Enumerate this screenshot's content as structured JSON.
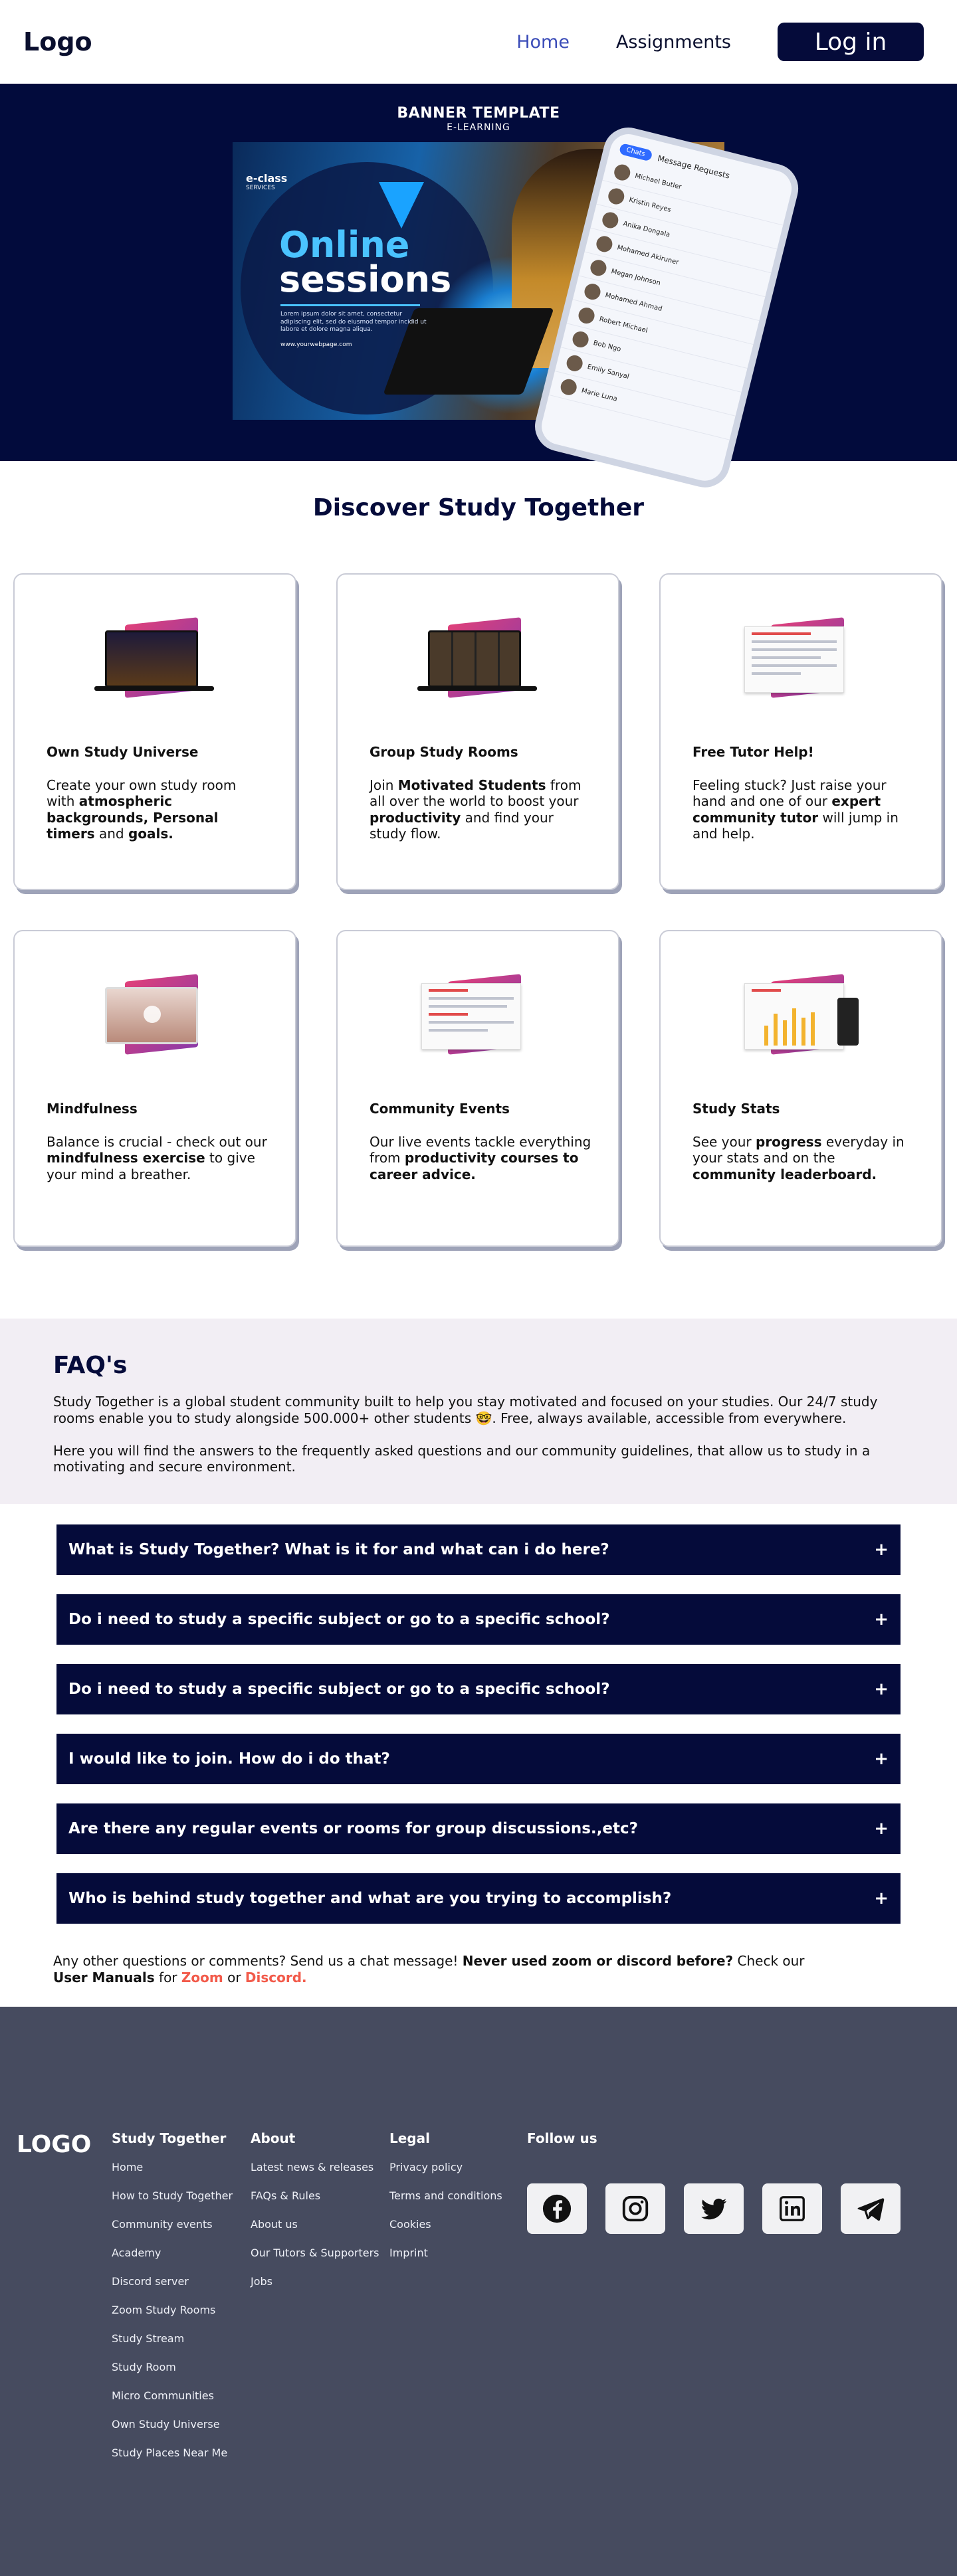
{
  "header": {
    "logo": "Logo",
    "nav": {
      "home": "Home",
      "assignments": "Assignments",
      "login": "Log in"
    }
  },
  "banner": {
    "title": "BANNER TEMPLATE",
    "subtitle": "E-LEARNING",
    "art": {
      "brand": "e-class",
      "brand_sub": "SERVICES",
      "headline_1": "Online",
      "headline_2": "sessions",
      "lorem": "Lorem ipsum dolor sit amet, consectetur adipiscing elit, sed do eiusmod tempor incidid ut labore et dolore magna aliqua.",
      "url": "www.yourwebpage.com",
      "phone_tab_1": "Chats",
      "phone_tab_2": "Message Requests",
      "phone_contacts": [
        "Michael Butler",
        "Kristin Reyes",
        "Anika Dongala",
        "Mohamed Akiruner",
        "Megan Johnson",
        "Mohamed Ahmad",
        "Robert Michael",
        "Bob Ngo",
        "Emily Sanyal",
        "Marie Luna"
      ]
    }
  },
  "discover": {
    "title": "Discover Study Together",
    "cards": [
      {
        "heading": "Own Study Universe",
        "body": [
          {
            "t": "Create your own study room with ",
            "b": false
          },
          {
            "t": "atmospheric backgrounds, Personal timers",
            "b": true
          },
          {
            "t": " and ",
            "b": false
          },
          {
            "t": "goals.",
            "b": true
          }
        ]
      },
      {
        "heading": "Group Study Rooms",
        "body": [
          {
            "t": "Join ",
            "b": false
          },
          {
            "t": "Motivated Students",
            "b": true
          },
          {
            "t": " from all over the world to boost your ",
            "b": false
          },
          {
            "t": "productivity",
            "b": true
          },
          {
            "t": " and find your study flow.",
            "b": false
          }
        ]
      },
      {
        "heading": "Free Tutor Help!",
        "body": [
          {
            "t": "Feeling stuck? Just raise your hand and one of our ",
            "b": false
          },
          {
            "t": "expert community tutor",
            "b": true
          },
          {
            "t": " will jump in and help.",
            "b": false
          }
        ]
      },
      {
        "heading": "Mindfulness",
        "body": [
          {
            "t": "Balance is crucial - check out our ",
            "b": false
          },
          {
            "t": "mindfulness exercise",
            "b": true
          },
          {
            "t": " to give your mind a breather.",
            "b": false
          }
        ]
      },
      {
        "heading": "Community Events",
        "body": [
          {
            "t": "Our live events tackle everything from ",
            "b": false
          },
          {
            "t": "productivity courses to career advice.",
            "b": true
          }
        ]
      },
      {
        "heading": "Study Stats",
        "body": [
          {
            "t": "See your ",
            "b": false
          },
          {
            "t": "progress",
            "b": true
          },
          {
            "t": " everyday in your stats and on the ",
            "b": false
          },
          {
            "t": "community leaderboard.",
            "b": true
          }
        ]
      }
    ]
  },
  "faq": {
    "title": "FAQ's",
    "intro_1": "Study Together is a global student community built to help you stay motivated and focused on your studies. Our 24/7 study rooms enable you to study alongside 500.000+ other students 🤓. Free, always available, accessible from everywhere.",
    "intro_2": "Here you will find the answers to the frequently asked questions and our community guidelines, that allow us to study in a motivating and secure environment.",
    "questions": [
      "What is Study Together? What is it for and what can i do here?",
      "Do i need to study a specific subject or go to a specific school?",
      "Do i need to study a specific subject or go to a specific school?",
      "I would like to join. How do i do that?",
      "Are there any regular events or rooms for group discussions.,etc?",
      "Who is behind study together and what are you trying to accomplish?"
    ],
    "expand_symbol": "+",
    "note": {
      "pre": "Any other questions or comments? Send us a chat message! ",
      "bold": "Never used zoom or discord before?",
      "mid": " Check our ",
      "manuals": "User Manuals",
      "for": " for ",
      "zoom": "Zoom",
      "or": " or ",
      "discord": "Discord."
    }
  },
  "footer": {
    "logo": "LOGO",
    "columns": [
      {
        "title": "Study Together",
        "links": [
          "Home",
          "How to Study Together",
          "Community events",
          "Academy",
          "Discord server",
          "Zoom Study Rooms",
          "Study Stream",
          "Study Room",
          "Micro Communities",
          "Own Study Universe",
          "Study Places Near Me"
        ]
      },
      {
        "title": "About",
        "links": [
          "Latest news & releases",
          "FAQs & Rules",
          "About us",
          "Our Tutors & Supporters",
          "Jobs"
        ]
      },
      {
        "title": "Legal",
        "links": [
          "Privacy policy",
          "Terms and conditions",
          "Cookies",
          "Imprint"
        ]
      }
    ],
    "follow_title": "Follow us",
    "social_icons": [
      "facebook-icon",
      "instagram-icon",
      "twitter-icon",
      "linkedin-icon",
      "telegram-icon"
    ]
  },
  "colors": {
    "navy": "#050b3a",
    "banner_bg": "#020b3c",
    "nav_active": "#3b4cb8",
    "faq_bg": "#f2eef4",
    "footer_bg": "#464b5f",
    "link_red": "#f25a4a"
  }
}
